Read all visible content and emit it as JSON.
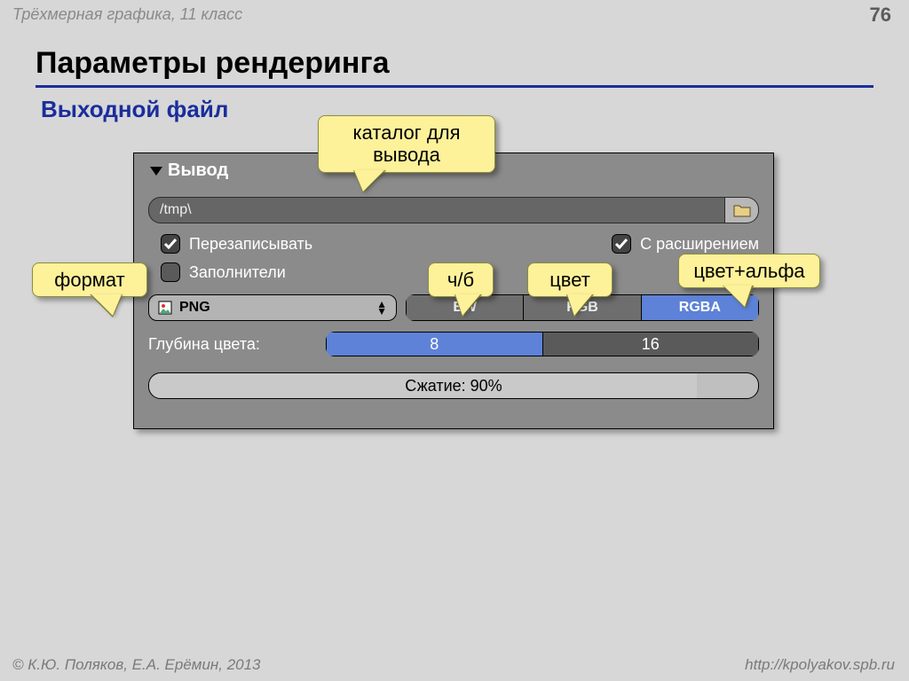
{
  "header": {
    "course": "Трёхмерная графика, 11 класс",
    "slide_no": "76"
  },
  "title": "Параметры рендеринга",
  "subtitle": "Выходной файл",
  "panel": {
    "section": "Вывод",
    "path": "/tmp\\",
    "overwrite_label": "Перезаписывать",
    "with_ext_label": "С расширением",
    "placeholders_label": "Заполнители",
    "format": "PNG",
    "color_modes": {
      "bw": "BW",
      "rgb": "RGB",
      "rgba": "RGBA",
      "active": "rgba"
    },
    "depth_label": "Глубина цвета:",
    "depth": {
      "d8": "8",
      "d16": "16",
      "active": "d8"
    },
    "compression_label": "Сжатие: 90%",
    "compression_value": 90
  },
  "callouts": {
    "catalog": "каталог для вывода",
    "format": "формат",
    "bw": "ч/б",
    "color": "цвет",
    "alpha": "цвет+альфа"
  },
  "footer": {
    "left": "© К.Ю. Поляков, Е.А. Ерёмин, 2013",
    "right": "http://kpolyakov.spb.ru"
  }
}
